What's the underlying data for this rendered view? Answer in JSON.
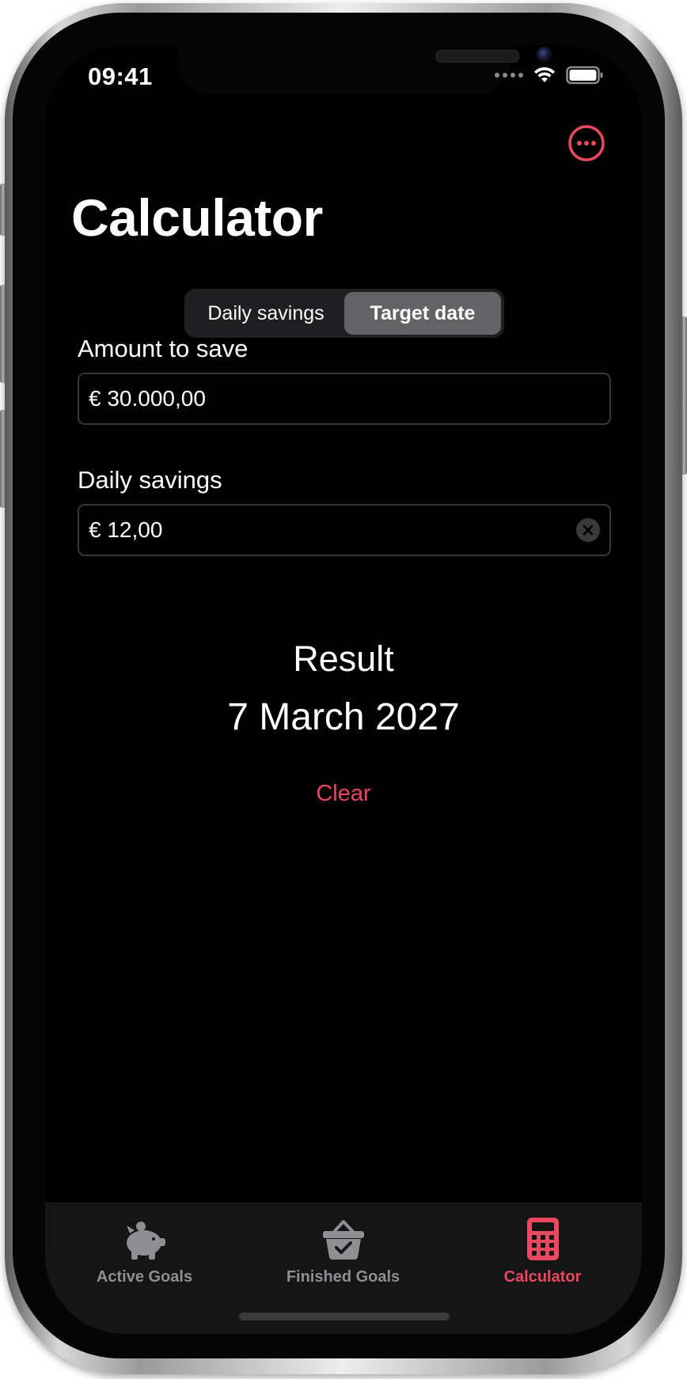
{
  "status_bar": {
    "time": "09:41"
  },
  "header": {
    "title": "Calculator"
  },
  "segmented_control": {
    "options": [
      "Daily savings",
      "Target date"
    ],
    "selected": "Target date"
  },
  "fields": {
    "amount": {
      "label": "Amount to save",
      "value": "€ 30.000,00"
    },
    "daily": {
      "label": "Daily savings",
      "value": "€ 12,00"
    }
  },
  "result": {
    "label": "Result",
    "value": "7 March 2027"
  },
  "actions": {
    "clear_label": "Clear"
  },
  "tab_bar": {
    "items": [
      {
        "label": "Active Goals",
        "icon": "piggy-bank-icon"
      },
      {
        "label": "Finished Goals",
        "icon": "basket-check-icon"
      },
      {
        "label": "Calculator",
        "icon": "calculator-icon"
      }
    ],
    "selected": "Calculator"
  },
  "colors": {
    "accent": "#e84860",
    "background": "#000000",
    "inactive_tab": "#8e8e93"
  }
}
